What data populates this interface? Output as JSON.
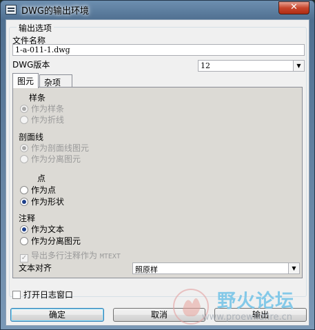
{
  "window": {
    "title": "DWG的输出环境",
    "close_label": "✕"
  },
  "output_options": {
    "group_label": "输出选项",
    "filename_label": "文件名称",
    "filename_value": "1-a-011-1.dwg",
    "version_label": "DWG版本",
    "version_value": "12"
  },
  "tabs": [
    {
      "label": "图元"
    },
    {
      "label": "杂项"
    }
  ],
  "spline": {
    "heading": "样条",
    "as_spline": "作为样条",
    "as_polyline": "作为折线"
  },
  "hatch": {
    "heading": "剖面线",
    "as_hatch_entity": "作为剖面线图元",
    "as_separate_entity": "作为分离图元"
  },
  "point": {
    "heading": "点",
    "as_point": "作为点",
    "as_shape": "作为形状"
  },
  "annotation": {
    "heading": "注释",
    "as_text": "作为文本",
    "as_separate_entity": "作为分离图元",
    "export_multiline_prefix": "导出多行注释作为",
    "export_multiline_suffix": "MTEXT",
    "text_align_label": "文本对齐",
    "text_align_value": "照原样"
  },
  "log": {
    "open_log_label": "打开日志窗口"
  },
  "buttons": {
    "ok": "确定",
    "cancel": "取消",
    "export": "输出"
  },
  "watermark": {
    "site_name": "野火论坛",
    "url_fragment": "www.proewildfire.cn"
  },
  "colors": {
    "title_gradient_top": "#6d8fb0",
    "tab_panel_bg": "#dcdad5",
    "radio_checked": "#1d3f8a",
    "watermark_blue": "#7fc7e8"
  }
}
